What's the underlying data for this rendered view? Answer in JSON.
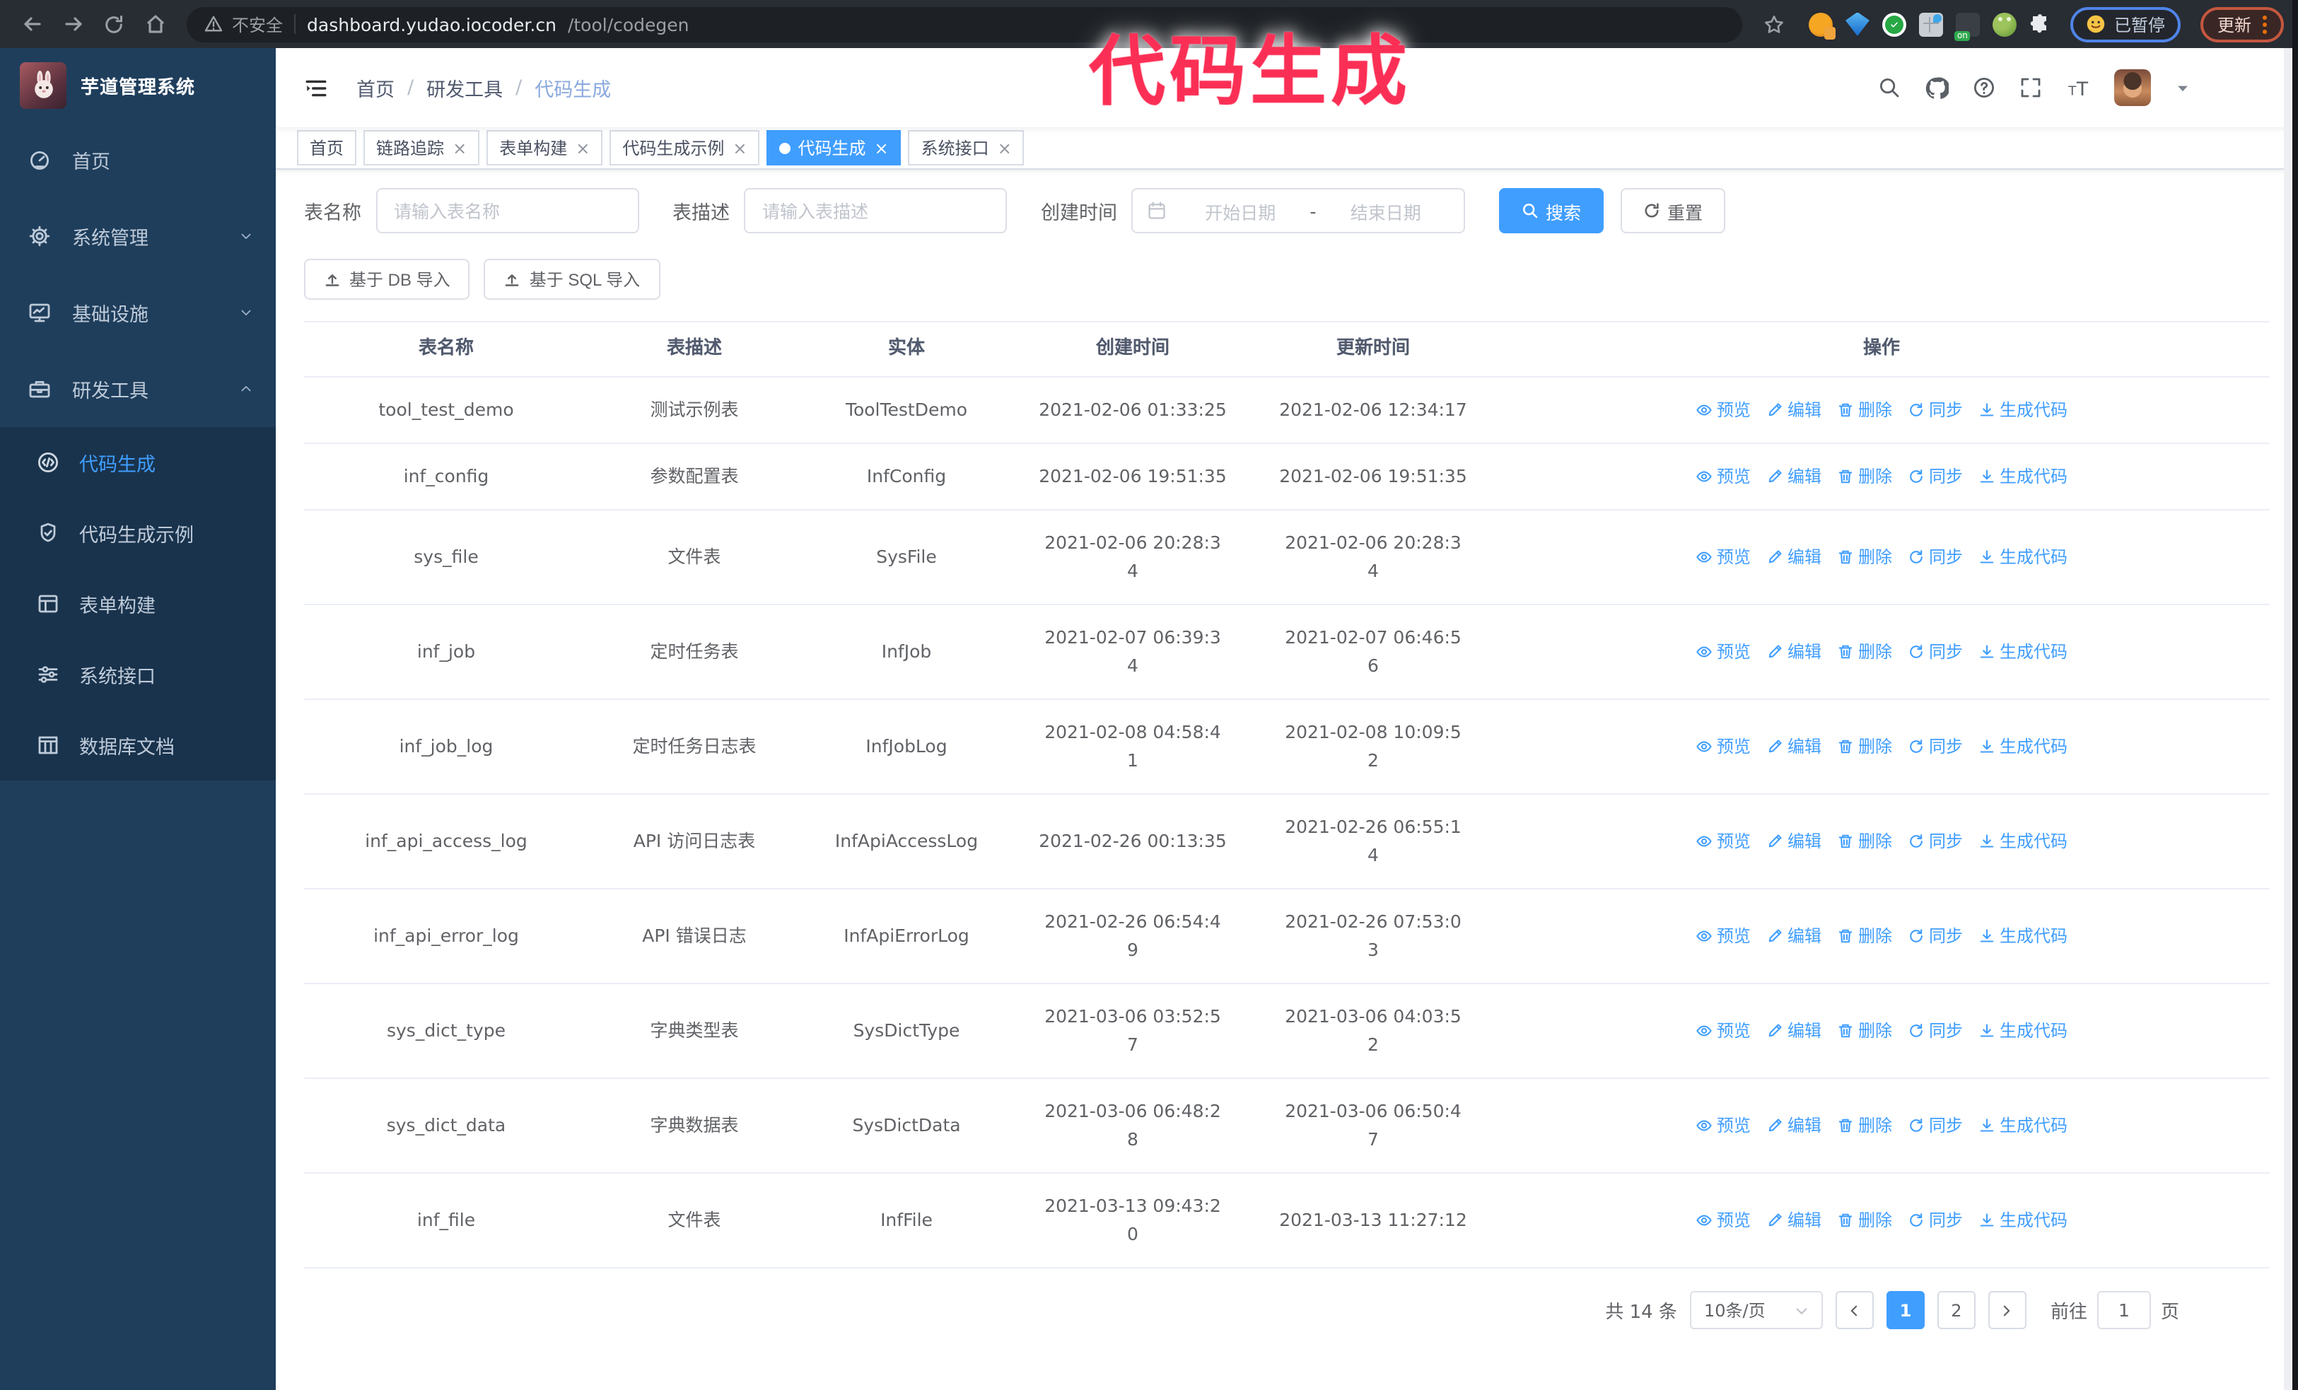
{
  "annotation": {
    "text": "代码生成"
  },
  "colors": {
    "accent": "#409EFF",
    "sidebar_bg": "#1f3e5c",
    "submenu_bg": "#19334d",
    "annotation": "#fb2f55"
  },
  "browser": {
    "security_label": "不安全",
    "url_host": "dashboard.yudao.iocoder.cn",
    "url_path": "/tool/codegen",
    "extensions": [
      "ext-orange",
      "ext-gem",
      "ext-check",
      "ext-grid",
      "ext-dark",
      "ext-frog",
      "ext-puzzle"
    ],
    "extension_badge": "on",
    "profile_chip_label": "已暂停",
    "update_button_label": "更新"
  },
  "sidebar": {
    "app_title": "芋道管理系统",
    "items": [
      {
        "label": "首页",
        "icon": "dashboard",
        "chevron": null,
        "active": false
      },
      {
        "label": "系统管理",
        "icon": "gear",
        "chevron": "down",
        "active": false
      },
      {
        "label": "基础设施",
        "icon": "monitor",
        "chevron": "down",
        "active": false
      },
      {
        "label": "研发工具",
        "icon": "toolbox",
        "chevron": "up",
        "active": false
      }
    ],
    "subitems": [
      {
        "label": "代码生成",
        "icon": "code",
        "active": true
      },
      {
        "label": "代码生成示例",
        "icon": "badge",
        "active": false
      },
      {
        "label": "表单构建",
        "icon": "form",
        "active": false
      },
      {
        "label": "系统接口",
        "icon": "sliders",
        "active": false
      },
      {
        "label": "数据库文档",
        "icon": "dbdoc",
        "active": false
      }
    ]
  },
  "header": {
    "breadcrumb": [
      "首页",
      "研发工具",
      "代码生成"
    ],
    "separator": "/",
    "tools": [
      {
        "icon": "search"
      },
      {
        "icon": "github"
      },
      {
        "icon": "help"
      },
      {
        "icon": "fullscreen"
      },
      {
        "icon": "font-size"
      }
    ]
  },
  "tabs": [
    {
      "label": "首页",
      "closable": false,
      "active": false
    },
    {
      "label": "链路追踪",
      "closable": true,
      "active": false
    },
    {
      "label": "表单构建",
      "closable": true,
      "active": false
    },
    {
      "label": "代码生成示例",
      "closable": true,
      "active": false
    },
    {
      "label": "代码生成",
      "closable": true,
      "active": true
    },
    {
      "label": "系统接口",
      "closable": true,
      "active": false
    }
  ],
  "filters": {
    "name_label": "表名称",
    "name_placeholder": "请输入表名称",
    "desc_label": "表描述",
    "desc_placeholder": "请输入表描述",
    "time_label": "创建时间",
    "start_placeholder": "开始日期",
    "range_separator": "-",
    "end_placeholder": "结束日期",
    "search_label": "搜索",
    "reset_label": "重置"
  },
  "toolbar": {
    "import_db_label": "基于 DB 导入",
    "import_sql_label": "基于 SQL 导入",
    "mini": [
      {
        "icon": "search"
      },
      {
        "icon": "refresh"
      }
    ]
  },
  "table": {
    "columns": [
      "表名称",
      "表描述",
      "实体",
      "创建时间",
      "更新时间",
      "操作"
    ],
    "row_actions": [
      {
        "name": "preview",
        "label": "预览",
        "icon": "eye"
      },
      {
        "name": "edit",
        "label": "编辑",
        "icon": "edit"
      },
      {
        "name": "delete",
        "label": "删除",
        "icon": "trash"
      },
      {
        "name": "sync",
        "label": "同步",
        "icon": "sync"
      },
      {
        "name": "generate-code",
        "label": "生成代码",
        "icon": "download"
      }
    ],
    "rows": [
      {
        "name": "tool_test_demo",
        "desc": "测试示例表",
        "entity": "ToolTestDemo",
        "created": "2021-02-06 01:33:25",
        "updated": "2021-02-06 12:34:17"
      },
      {
        "name": "inf_config",
        "desc": "参数配置表",
        "entity": "InfConfig",
        "created": "2021-02-06 19:51:35",
        "updated": "2021-02-06 19:51:35"
      },
      {
        "name": "sys_file",
        "desc": "文件表",
        "entity": "SysFile",
        "created": "2021-02-06 20:28:3\n4",
        "updated": "2021-02-06 20:28:3\n4"
      },
      {
        "name": "inf_job",
        "desc": "定时任务表",
        "entity": "InfJob",
        "created": "2021-02-07 06:39:3\n4",
        "updated": "2021-02-07 06:46:5\n6"
      },
      {
        "name": "inf_job_log",
        "desc": "定时任务日志表",
        "entity": "InfJobLog",
        "created": "2021-02-08 04:58:4\n1",
        "updated": "2021-02-08 10:09:5\n2"
      },
      {
        "name": "inf_api_access_log",
        "desc": "API 访问日志表",
        "entity": "InfApiAccessLog",
        "created": "2021-02-26 00:13:35",
        "updated": "2021-02-26 06:55:1\n4"
      },
      {
        "name": "inf_api_error_log",
        "desc": "API 错误日志",
        "entity": "InfApiErrorLog",
        "created": "2021-02-26 06:54:4\n9",
        "updated": "2021-02-26 07:53:0\n3"
      },
      {
        "name": "sys_dict_type",
        "desc": "字典类型表",
        "entity": "SysDictType",
        "created": "2021-03-06 03:52:5\n7",
        "updated": "2021-03-06 04:03:5\n2"
      },
      {
        "name": "sys_dict_data",
        "desc": "字典数据表",
        "entity": "SysDictData",
        "created": "2021-03-06 06:48:2\n8",
        "updated": "2021-03-06 06:50:4\n7"
      },
      {
        "name": "inf_file",
        "desc": "文件表",
        "entity": "InfFile",
        "created": "2021-03-13 09:43:2\n0",
        "updated": "2021-03-13 11:27:12"
      }
    ]
  },
  "pagination": {
    "total_label": "共 14 条",
    "page_size_label": "10条/页",
    "pages": [
      "1",
      "2"
    ],
    "active_page": "1",
    "goto_label": "前往",
    "goto_value": "1",
    "goto_unit": "页"
  }
}
